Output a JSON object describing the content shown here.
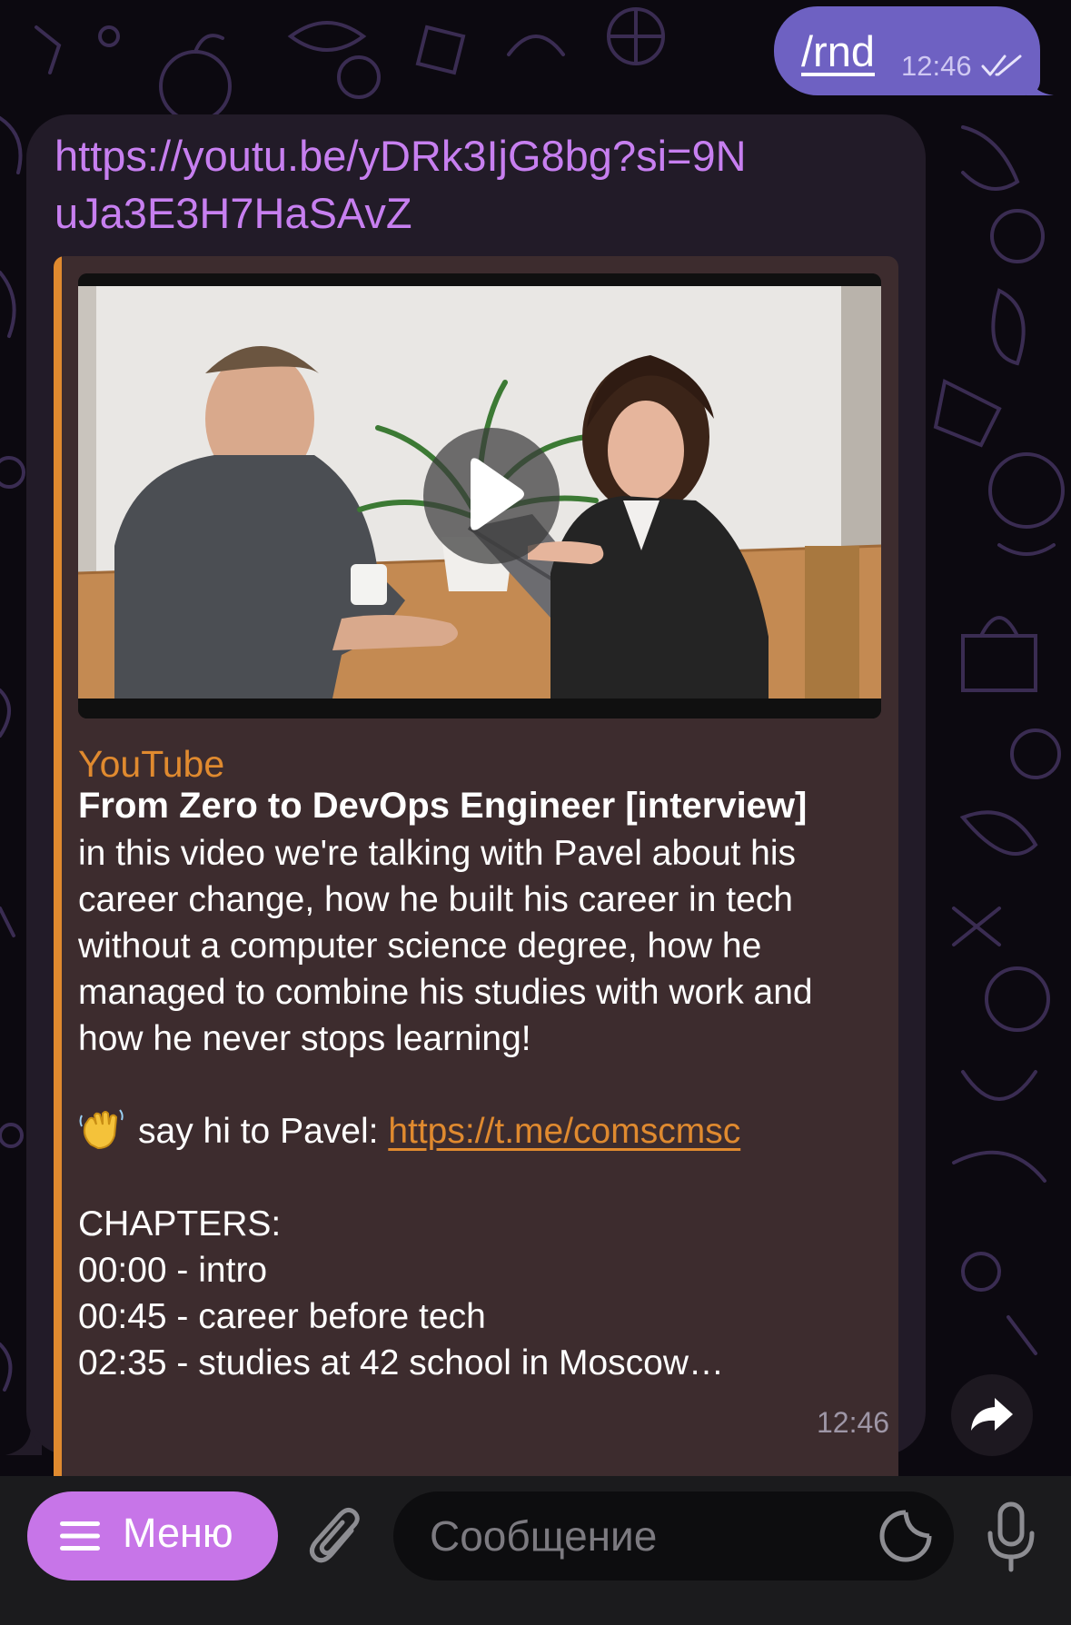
{
  "outgoing_message": {
    "text": "/rnd",
    "time": "12:46"
  },
  "incoming_message": {
    "url": "https://youtu.be/yDRk3IjG8bg?si=9NuJa3E3H7HaSAvZ",
    "time": "12:46",
    "preview": {
      "site_name": "YouTube",
      "title": "From Zero to DevOps Engineer [interview]",
      "description_lines": [
        "in this video we're talking with Pavel about his career change, how he built his career in tech without a computer science degree, how he managed to combine his studies with work and how he never stops learning!"
      ],
      "say_hi_text": "say hi to Pavel: ",
      "say_hi_link": "https://t.me/comscmsc",
      "chapters_header": "CHAPTERS:",
      "chapters": [
        "00:00 - intro",
        "00:45 - career before tech",
        "02:35 - studies at 42 school in Moscow…"
      ]
    }
  },
  "input_bar": {
    "menu_label": "Меню",
    "message_placeholder": "Сообщение"
  },
  "icons": {
    "read_receipt": "double-check-icon",
    "play": "play-icon",
    "wave": "waving-hand-emoji",
    "forward": "forward-arrow-icon",
    "menu": "hamburger-icon",
    "attach": "paperclip-icon",
    "sticker": "sticker-icon",
    "mic": "microphone-icon"
  },
  "colors": {
    "outgoing_bubble": "#6e61c2",
    "incoming_bubble": "#221b28",
    "link_purple": "#c77ff0",
    "preview_accent": "#e08a2f",
    "menu_button": "#c775e8"
  }
}
